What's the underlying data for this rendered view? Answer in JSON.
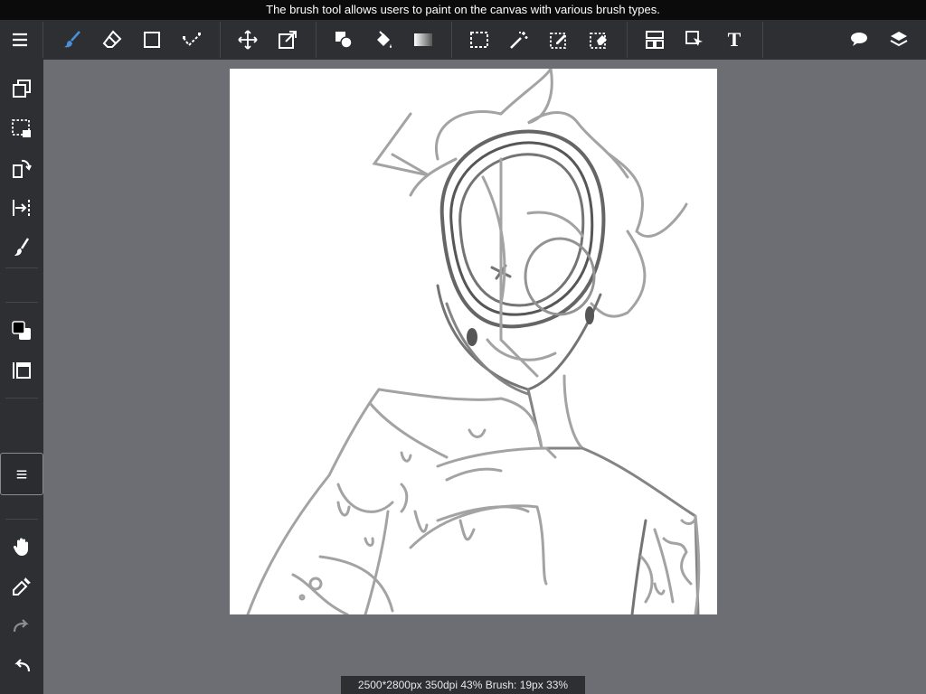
{
  "tooltip": {
    "text": "The brush tool allows users to paint on the canvas with various brush types."
  },
  "status": {
    "text": "2500*2800px 350dpi 43% Brush: 19px 33%"
  },
  "colors": {
    "accent": "#4a90d9",
    "toolbar_bg": "#2e2f33",
    "workspace_bg": "#6d6e73",
    "icon": "#ffffff"
  },
  "toolbar": {
    "menu": {
      "icon": "hamburger-icon"
    },
    "tools": [
      {
        "name": "brush",
        "icon": "brush-icon",
        "active": true
      },
      {
        "name": "eraser",
        "icon": "eraser-icon"
      },
      {
        "name": "shape",
        "icon": "square-icon"
      },
      {
        "name": "select-line",
        "icon": "dot-line-icon"
      },
      {
        "name": "move",
        "icon": "move-icon"
      },
      {
        "name": "transform",
        "icon": "transform-icon"
      },
      {
        "name": "fill-shape",
        "icon": "shapes-icon"
      },
      {
        "name": "bucket",
        "icon": "bucket-icon"
      },
      {
        "name": "gradient",
        "icon": "gradient-icon"
      },
      {
        "name": "select",
        "icon": "marquee-icon"
      },
      {
        "name": "magic-wand",
        "icon": "magic-wand-icon"
      },
      {
        "name": "select-pen",
        "icon": "select-pen-icon"
      },
      {
        "name": "select-eraser",
        "icon": "select-eraser-icon"
      },
      {
        "name": "frame",
        "icon": "frame-icon"
      },
      {
        "name": "operation",
        "icon": "cursor-icon"
      },
      {
        "name": "text",
        "icon": "text-icon",
        "glyph": "T"
      }
    ],
    "right": [
      {
        "name": "comment",
        "icon": "speech-bubble-icon"
      },
      {
        "name": "layers",
        "icon": "layers-icon"
      }
    ]
  },
  "sidebar": {
    "items": [
      {
        "name": "copy-layer",
        "icon": "copy-icon"
      },
      {
        "name": "selection-layer",
        "icon": "selection-icon"
      },
      {
        "name": "rotate",
        "icon": "rotate-icon"
      },
      {
        "name": "flip",
        "icon": "flip-icon"
      },
      {
        "name": "brush-small",
        "icon": "brush-icon"
      },
      {
        "name": "color",
        "icon": "color-swatch-icon",
        "fg": "#000000",
        "bg": "#ffffff"
      },
      {
        "name": "frame-side",
        "icon": "frame-icon"
      },
      {
        "name": "menu",
        "icon": "hamburger-icon"
      },
      {
        "name": "hand",
        "icon": "hand-icon"
      },
      {
        "name": "eyedropper",
        "icon": "eyedropper-icon"
      },
      {
        "name": "redo",
        "icon": "redo-icon"
      },
      {
        "name": "undo",
        "icon": "undo-icon"
      }
    ]
  }
}
